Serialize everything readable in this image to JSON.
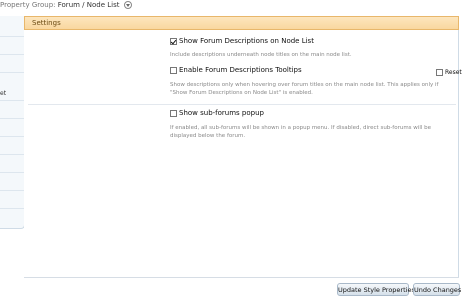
{
  "breadcrumb": {
    "prefix": "Property Group:",
    "current": "Forum / Node List"
  },
  "sidebar": {
    "partial_text": "et"
  },
  "panel": {
    "title": "Settings"
  },
  "options": [
    {
      "label": "Show Forum Descriptions on Node List",
      "checked": true,
      "description": "Include descriptions underneath node titles on the main node list."
    },
    {
      "label": "Enable Forum Descriptions Tooltips",
      "checked": false,
      "description": "Show descriptions only when hovering over forum titles on the main node list. This applies only if \"Show Forum Descriptions on Node List\" is enabled."
    },
    {
      "label": "Show sub-forums popup",
      "checked": false,
      "description": "If enabled, all sub-forums will be shown in a popup menu. If disabled, direct sub-forums will be displayed below the forum."
    }
  ],
  "reset": {
    "label": "Reset",
    "checked": false
  },
  "buttons": {
    "update": "Update Style Properties",
    "undo": "Undo Changes"
  }
}
